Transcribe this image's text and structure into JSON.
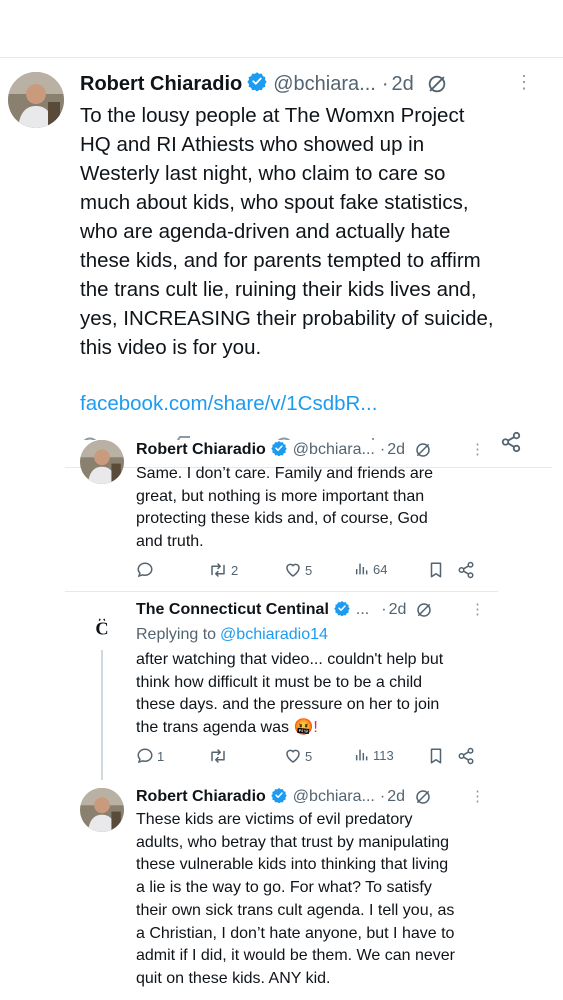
{
  "colors": {
    "accent": "#1d9bf0",
    "verified": "#1d9bf0",
    "muted": "#536471",
    "text": "#0f1419",
    "emoji": "#e0245e"
  },
  "main_tweet": {
    "author": "Robert Chiaradio",
    "handle": "@bchiara...",
    "separator": "·",
    "time": "2d",
    "more": "⋮",
    "text": "To the lousy people at The Womxn Project\nHQ and RI Athiests who showed up in\nWesterly last night, who claim to care so\nmuch about kids, who spout fake statistics,\nwho are agenda-driven and actually hate\nthese kids, and for parents tempted to affirm\nthe trans cult lie, ruining their kids lives and,\nyes, INCREASING their probability of suicide,\nthis video is for you.",
    "link": "facebook.com/share/v/1CsdbR..."
  },
  "replies": [
    {
      "author": "Robert Chiaradio",
      "handle": "@bchiara...",
      "separator": "·",
      "time": "2d",
      "more": "⋮",
      "text": "Same. I don’t care. Family and friends are\ngreat, but nothing is more important than\nprotecting these kids and, of course, God\nand truth.",
      "stats": {
        "replies": "",
        "reposts": "2",
        "likes": "5",
        "views": "64"
      }
    },
    {
      "author": "The Connecticut Centinal",
      "handle": "...",
      "separator": "·",
      "time": "2d",
      "more": "⋮",
      "replying_label": "Replying to",
      "replying_handle": "@bchiaradio14",
      "text": "after watching that video... couldn't help but\nthink how difficult it must be to be a child\nthese days.  and the pressure on her to join\nthe trans agenda was",
      "emoji_suffix": "🤬!",
      "stats": {
        "replies": "1",
        "reposts": "",
        "likes": "5",
        "views": "113"
      }
    },
    {
      "author": "Robert Chiaradio",
      "handle": "@bchiara...",
      "separator": "·",
      "time": "2d",
      "more": "⋮",
      "text": "These kids are victims of evil predatory\nadults, who betray that trust by manipulating\nthese vulnerable kids into thinking that living\na lie is the way to go. For what?  To satisfy\ntheir own sick trans cult agenda. I tell you, as\na Christian, I don’t hate anyone, but I have to\nadmit if I did, it would be them. We can never\nquit on these kids. ANY kid."
    }
  ]
}
